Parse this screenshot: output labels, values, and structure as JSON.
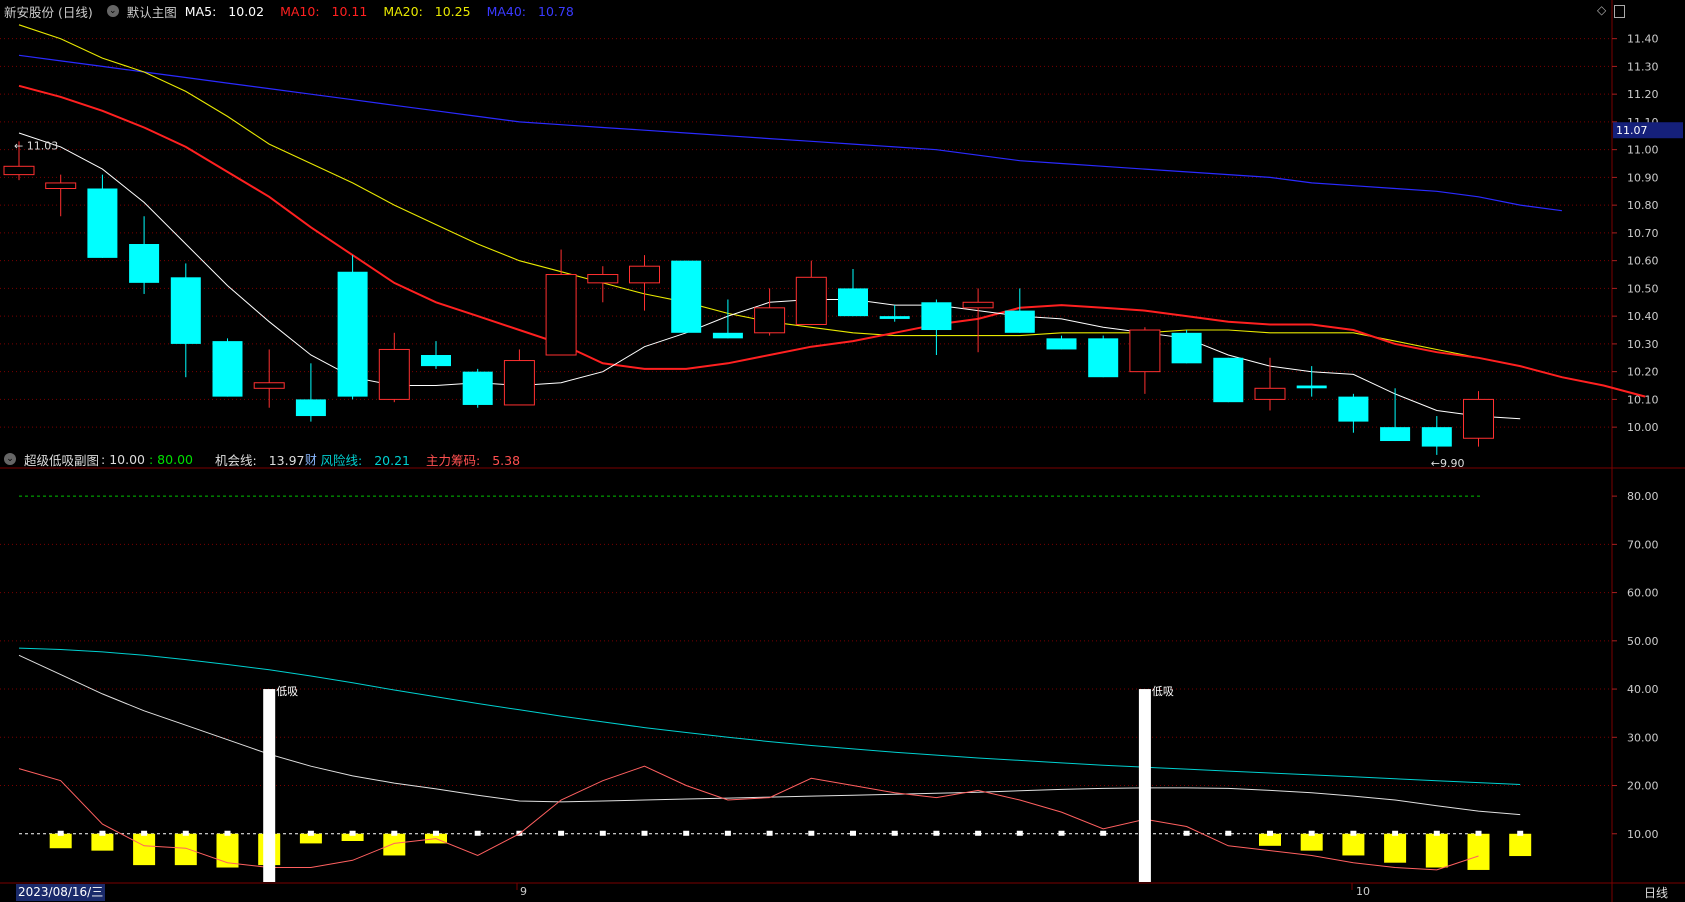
{
  "top_header": {
    "stock_name": "新安股份",
    "period": "(日线)",
    "chart_menu": "默认主图",
    "ma5": {
      "label": "MA5:",
      "value": "10.02",
      "color": "#ffffff"
    },
    "ma10": {
      "label": "MA10:",
      "value": "10.11",
      "color": "#ff2020"
    },
    "ma20": {
      "label": "MA20:",
      "value": "10.25",
      "color": "#e8e800"
    },
    "ma40": {
      "label": "MA40:",
      "value": "10.78",
      "color": "#2a2aff"
    }
  },
  "bottom_header": {
    "indicator_name": "超级低吸副图",
    "v1": ": 10.00",
    "v2": ": 80.00",
    "chance_label": "机会线:",
    "chance_value": "13.97",
    "risk_label": "风险线:",
    "risk_value": "20.21",
    "chips_label": "主力筹码:",
    "chips_value": "5.38"
  },
  "footer": {
    "date": "2023/08/16/三",
    "month_marks": [
      "9",
      "10"
    ],
    "period_button": "日线"
  },
  "colors": {
    "bg": "#000000",
    "up": "#ff3030",
    "down": "#00ffff",
    "grid": "#7a0000",
    "ma5": "#ffffff",
    "ma10": "#ff2020",
    "ma20": "#e8e800",
    "ma40": "#2a2aff",
    "chance": "#e0e0e0",
    "risk": "#00d0d0",
    "chips": "#ff6060",
    "bars": "#ffff00"
  },
  "chart_data": [
    {
      "type": "candlestick",
      "title": "新安股份 (日线)",
      "ylim": [
        9.86,
        11.46
      ],
      "y_ticks": [
        "11.40",
        "11.30",
        "11.20",
        "11.10",
        "11.00",
        "10.90",
        "10.80",
        "10.70",
        "10.60",
        "10.50",
        "10.40",
        "10.30",
        "10.20",
        "10.10",
        "10.00"
      ],
      "current_price_label": "11.07",
      "annotations": [
        {
          "text": "11.03",
          "bar": 0,
          "kind": "high"
        },
        {
          "text": "9.90",
          "bar": 34,
          "kind": "low"
        },
        {
          "text": "财",
          "bar": 7,
          "kind": "marker"
        }
      ],
      "candles": [
        {
          "o": 10.91,
          "h": 11.03,
          "l": 10.89,
          "c": 10.94
        },
        {
          "o": 10.86,
          "h": 10.91,
          "l": 10.76,
          "c": 10.88
        },
        {
          "o": 10.86,
          "h": 10.91,
          "l": 10.61,
          "c": 10.61
        },
        {
          "o": 10.66,
          "h": 10.76,
          "l": 10.48,
          "c": 10.52
        },
        {
          "o": 10.54,
          "h": 10.59,
          "l": 10.18,
          "c": 10.3
        },
        {
          "o": 10.31,
          "h": 10.32,
          "l": 10.11,
          "c": 10.11
        },
        {
          "o": 10.14,
          "h": 10.28,
          "l": 10.07,
          "c": 10.16
        },
        {
          "o": 10.1,
          "h": 10.23,
          "l": 10.02,
          "c": 10.04
        },
        {
          "o": 10.56,
          "h": 10.62,
          "l": 10.1,
          "c": 10.11
        },
        {
          "o": 10.1,
          "h": 10.34,
          "l": 10.09,
          "c": 10.28
        },
        {
          "o": 10.26,
          "h": 10.31,
          "l": 10.21,
          "c": 10.22
        },
        {
          "o": 10.2,
          "h": 10.21,
          "l": 10.07,
          "c": 10.08
        },
        {
          "o": 10.08,
          "h": 10.28,
          "l": 10.08,
          "c": 10.24
        },
        {
          "o": 10.26,
          "h": 10.64,
          "l": 10.26,
          "c": 10.55
        },
        {
          "o": 10.52,
          "h": 10.58,
          "l": 10.45,
          "c": 10.55
        },
        {
          "o": 10.52,
          "h": 10.62,
          "l": 10.42,
          "c": 10.58
        },
        {
          "o": 10.6,
          "h": 10.6,
          "l": 10.34,
          "c": 10.34
        },
        {
          "o": 10.34,
          "h": 10.46,
          "l": 10.32,
          "c": 10.32
        },
        {
          "o": 10.34,
          "h": 10.5,
          "l": 10.33,
          "c": 10.43
        },
        {
          "o": 10.37,
          "h": 10.6,
          "l": 10.37,
          "c": 10.54
        },
        {
          "o": 10.5,
          "h": 10.57,
          "l": 10.4,
          "c": 10.4
        },
        {
          "o": 10.4,
          "h": 10.44,
          "l": 10.38,
          "c": 10.39
        },
        {
          "o": 10.45,
          "h": 10.46,
          "l": 10.26,
          "c": 10.35
        },
        {
          "o": 10.43,
          "h": 10.5,
          "l": 10.27,
          "c": 10.45
        },
        {
          "o": 10.42,
          "h": 10.5,
          "l": 10.34,
          "c": 10.34
        },
        {
          "o": 10.32,
          "h": 10.33,
          "l": 10.28,
          "c": 10.28
        },
        {
          "o": 10.32,
          "h": 10.33,
          "l": 10.18,
          "c": 10.18
        },
        {
          "o": 10.2,
          "h": 10.36,
          "l": 10.12,
          "c": 10.35
        },
        {
          "o": 10.34,
          "h": 10.35,
          "l": 10.23,
          "c": 10.23
        },
        {
          "o": 10.25,
          "h": 10.25,
          "l": 10.09,
          "c": 10.09
        },
        {
          "o": 10.1,
          "h": 10.25,
          "l": 10.06,
          "c": 10.14
        },
        {
          "o": 10.15,
          "h": 10.22,
          "l": 10.11,
          "c": 10.14
        },
        {
          "o": 10.11,
          "h": 10.12,
          "l": 9.98,
          "c": 10.02
        },
        {
          "o": 10.0,
          "h": 10.14,
          "l": 9.95,
          "c": 9.95
        },
        {
          "o": 10.0,
          "h": 10.04,
          "l": 9.9,
          "c": 9.93
        },
        {
          "o": 9.96,
          "h": 10.13,
          "l": 9.93,
          "c": 10.1
        }
      ],
      "ma5": [
        11.06,
        11.01,
        10.93,
        10.81,
        10.66,
        10.51,
        10.38,
        10.26,
        10.18,
        10.15,
        10.15,
        10.16,
        10.15,
        10.16,
        10.2,
        10.29,
        10.34,
        10.4,
        10.45,
        10.46,
        10.46,
        10.44,
        10.44,
        10.42,
        10.4,
        10.39,
        10.36,
        10.34,
        10.32,
        10.26,
        10.22,
        10.2,
        10.19,
        10.12,
        10.06,
        10.04,
        10.03
      ],
      "ma10": [
        11.23,
        11.19,
        11.14,
        11.08,
        11.01,
        10.92,
        10.83,
        10.72,
        10.62,
        10.52,
        10.45,
        10.4,
        10.35,
        10.3,
        10.23,
        10.21,
        10.21,
        10.23,
        10.26,
        10.29,
        10.31,
        10.34,
        10.37,
        10.39,
        10.43,
        10.44,
        10.43,
        10.42,
        10.4,
        10.38,
        10.37,
        10.37,
        10.35,
        10.3,
        10.27,
        10.25,
        10.22,
        10.18,
        10.15,
        10.11
      ],
      "ma20": [
        11.45,
        11.4,
        11.33,
        11.28,
        11.21,
        11.12,
        11.02,
        10.95,
        10.88,
        10.8,
        10.73,
        10.66,
        10.6,
        10.56,
        10.52,
        10.48,
        10.45,
        10.41,
        10.38,
        10.36,
        10.34,
        10.33,
        10.33,
        10.33,
        10.33,
        10.34,
        10.34,
        10.34,
        10.35,
        10.35,
        10.34,
        10.34,
        10.34,
        10.31,
        10.28,
        10.25
      ],
      "ma40": [
        11.34,
        11.32,
        11.3,
        11.28,
        11.26,
        11.24,
        11.22,
        11.2,
        11.18,
        11.16,
        11.14,
        11.12,
        11.1,
        11.09,
        11.08,
        11.07,
        11.06,
        11.05,
        11.04,
        11.03,
        11.02,
        11.01,
        11.0,
        10.98,
        10.96,
        10.95,
        10.94,
        10.93,
        10.92,
        10.91,
        10.9,
        10.88,
        10.87,
        10.86,
        10.85,
        10.83,
        10.8,
        10.78
      ]
    },
    {
      "type": "line",
      "title": "超级低吸副图",
      "ylim": [
        0,
        85
      ],
      "y_ticks": [
        "80.00",
        "70.00",
        "60.00",
        "50.00",
        "40.00",
        "30.00",
        "20.00",
        "10.00"
      ],
      "series": [
        {
          "name": "机会线",
          "values": [
            47.0,
            43.0,
            39.0,
            35.5,
            32.5,
            29.5,
            26.5,
            24.0,
            22.0,
            20.5,
            19.3,
            18.0,
            16.8,
            16.6,
            16.8,
            17.0,
            17.2,
            17.4,
            17.6,
            17.8,
            18.0,
            18.2,
            18.4,
            18.6,
            18.9,
            19.2,
            19.4,
            19.5,
            19.5,
            19.4,
            19.0,
            18.5,
            17.8,
            17.0,
            15.8,
            14.7,
            13.97
          ]
        },
        {
          "name": "风险线",
          "values": [
            48.5,
            48.2,
            47.7,
            47.0,
            46.1,
            45.1,
            44.0,
            42.7,
            41.3,
            39.8,
            38.4,
            37.0,
            35.7,
            34.4,
            33.2,
            32.0,
            31.0,
            30.0,
            29.1,
            28.3,
            27.6,
            26.9,
            26.3,
            25.7,
            25.2,
            24.7,
            24.2,
            23.8,
            23.4,
            23.0,
            22.6,
            22.2,
            21.8,
            21.4,
            21.0,
            20.6,
            20.21
          ]
        },
        {
          "name": "主力筹码",
          "values": [
            23.5,
            21.0,
            12.0,
            7.5,
            7.0,
            4.0,
            3.0,
            3.0,
            4.5,
            8.0,
            9.0,
            5.5,
            10.0,
            17.0,
            21.0,
            24.0,
            20.0,
            17.0,
            17.5,
            21.5,
            20.0,
            18.5,
            17.5,
            19.0,
            17.0,
            14.5,
            11.0,
            13.0,
            11.5,
            7.5,
            6.5,
            5.5,
            4.0,
            3.0,
            2.5,
            5.38
          ]
        }
      ],
      "reference_lines": [
        10,
        80
      ],
      "bars_top": 10,
      "bars_bottom": [
        7.0,
        6.5,
        3.5,
        3.5,
        3.0,
        3.5,
        8.0,
        8.5,
        5.5,
        8.0,
        null,
        null,
        null,
        null,
        null,
        null,
        null,
        null,
        null,
        null,
        null,
        null,
        null,
        null,
        null,
        null,
        null,
        null,
        null,
        7.5,
        6.5,
        5.5,
        4.0,
        3.0,
        2.5,
        5.38
      ],
      "signals": [
        {
          "bar": 6,
          "text": "低吸"
        },
        {
          "bar": 27,
          "text": "低吸"
        }
      ]
    }
  ]
}
